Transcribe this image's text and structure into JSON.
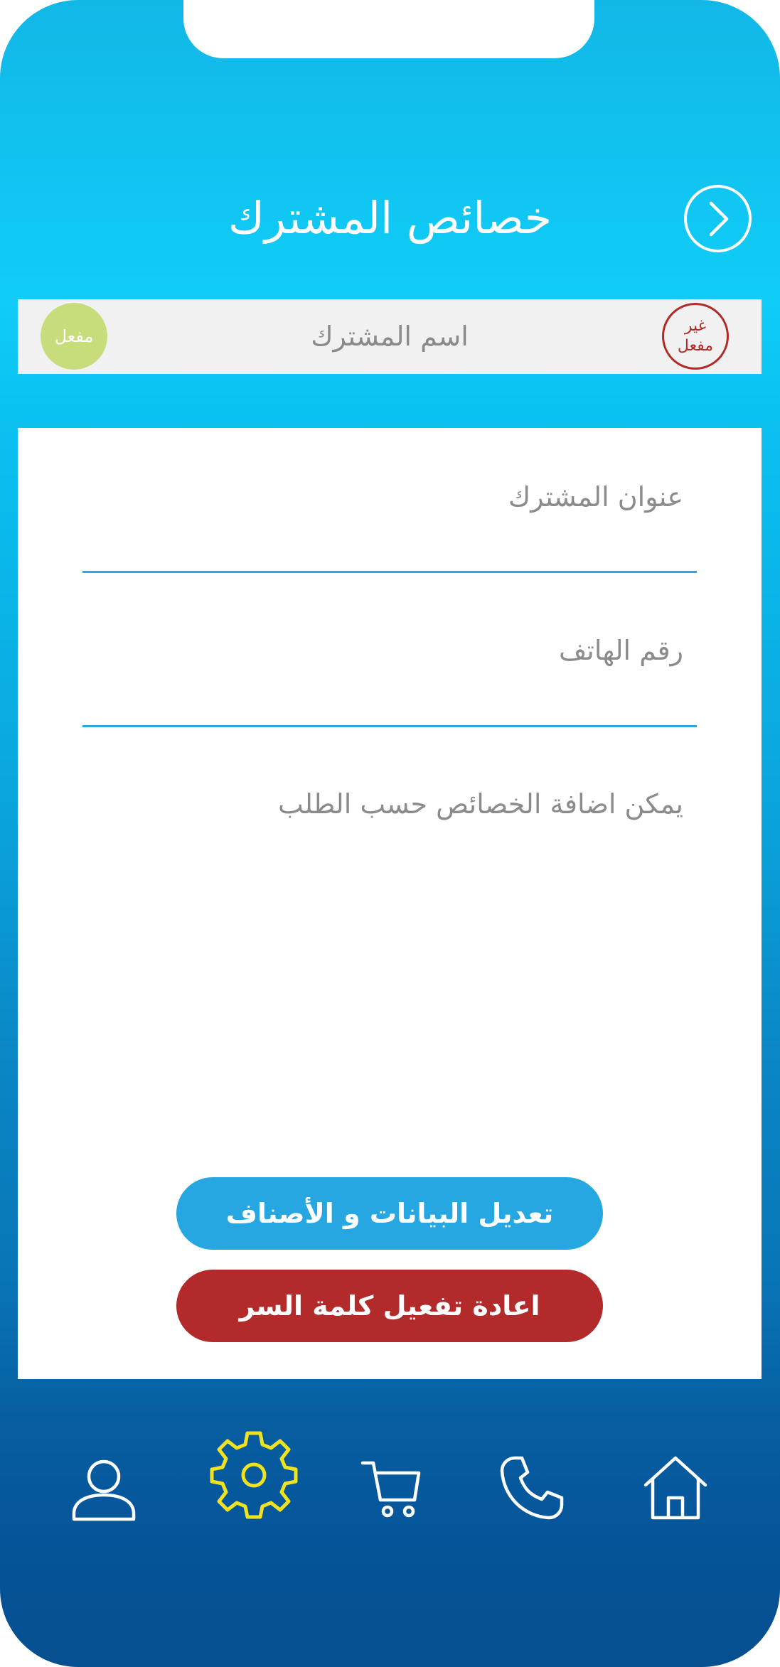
{
  "header": {
    "title": "خصائص المشترك"
  },
  "status_bar": {
    "name_label": "اسم المشترك",
    "active_badge": "مفعل",
    "inactive_badge_line1": "غير",
    "inactive_badge_line2": "مفعل"
  },
  "form": {
    "address_label": "عنوان المشترك",
    "phone_label": "رقم الهاتف",
    "note": "يمكن اضافة الخصائص حسب الطلب"
  },
  "actions": {
    "edit_label": "تعديل البيانات و الأصناف",
    "reset_password_label": "اعادة تفعيل كلمة السر"
  },
  "bottom_nav": {
    "items": [
      "user-icon",
      "settings-gear-icon",
      "cart-icon",
      "phone-icon",
      "home-icon"
    ],
    "active": "settings-gear-icon",
    "active_color": "#f0e21e",
    "inactive_color": "#ffffff"
  },
  "colors": {
    "accent_blue": "#26a7e1",
    "danger_red": "#b22a2a",
    "active_green": "#c7dd7c"
  }
}
